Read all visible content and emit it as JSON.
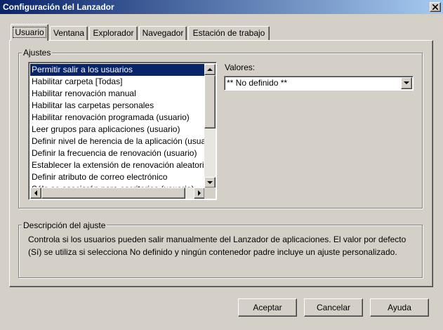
{
  "window": {
    "title": "Configuración del Lanzador"
  },
  "tabs": [
    {
      "label": "Usuario",
      "active": true
    },
    {
      "label": "Ventana",
      "active": false
    },
    {
      "label": "Explorador",
      "active": false
    },
    {
      "label": "Navegador",
      "active": false
    },
    {
      "label": "Estación de trabajo",
      "active": false
    }
  ],
  "settings_group": {
    "label": "Ajustes",
    "items": [
      "Permitir salir a los usuarios",
      "Habilitar carpeta [Todas]",
      "Habilitar renovación manual",
      "Habilitar las carpetas personales",
      "Habilitar renovación programada (usuario)",
      "Leer grupos para aplicaciones (usuario)",
      "Definir nivel de herencia de la aplicación (usuario)",
      "Definir la frecuencia de renovación (usuario)",
      "Establecer la extensión de renovación aleatoria",
      "Definir atributo de correo electrónico",
      "Sólo se asociarán para escritorios (usuario)"
    ],
    "selected_index": 0
  },
  "values": {
    "label": "Valores:",
    "selected": "** No definido **"
  },
  "description_group": {
    "label": "Descripción del ajuste",
    "text": "Controla si los usuarios pueden salir manualmente del Lanzador de aplicaciones. El valor por defecto (Sí) se utiliza si selecciona No definido y ningún contenedor padre incluye un ajuste personalizado."
  },
  "buttons": {
    "accept": "Aceptar",
    "cancel": "Cancelar",
    "help": "Ayuda"
  },
  "colors": {
    "face": "#d4d0c8",
    "title_active": "#0a246a",
    "selection": "#0a246a"
  }
}
